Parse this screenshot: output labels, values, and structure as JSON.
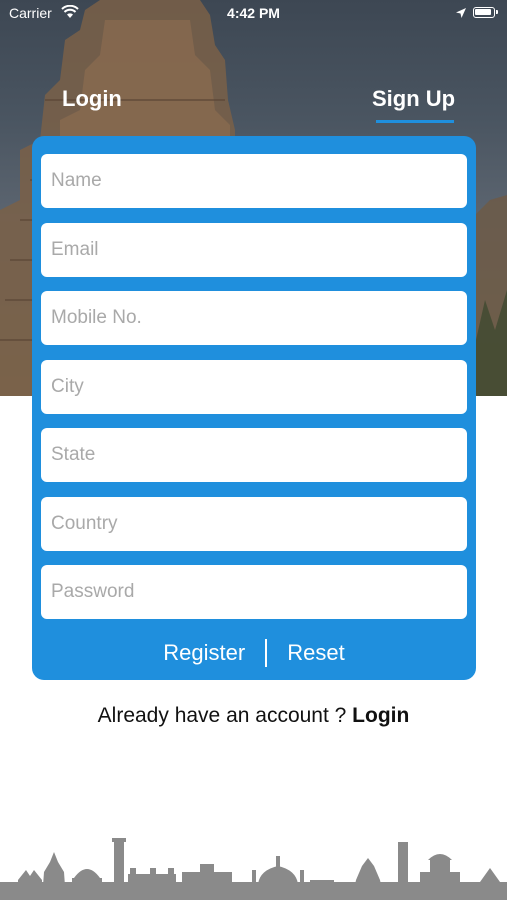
{
  "status_bar": {
    "carrier": "Carrier",
    "time": "4:42 PM",
    "wifi_icon": "wifi-icon",
    "location_icon": "location-arrow-icon",
    "battery_icon": "battery-icon"
  },
  "tabs": {
    "login_label": "Login",
    "signup_label": "Sign Up",
    "active": "signup"
  },
  "form": {
    "fields": [
      {
        "key": "name",
        "placeholder": "Name",
        "value": ""
      },
      {
        "key": "email",
        "placeholder": "Email",
        "value": ""
      },
      {
        "key": "mobile",
        "placeholder": "Mobile No.",
        "value": ""
      },
      {
        "key": "city",
        "placeholder": "City",
        "value": ""
      },
      {
        "key": "state",
        "placeholder": "State",
        "value": ""
      },
      {
        "key": "country",
        "placeholder": "Country",
        "value": ""
      },
      {
        "key": "password",
        "placeholder": "Password",
        "value": ""
      }
    ],
    "register_label": "Register",
    "reset_label": "Reset"
  },
  "footer": {
    "prompt": "Already have an account ? ",
    "login_link": "Login"
  },
  "colors": {
    "accent": "#1f8fdd",
    "skyline": "#8a8a8a"
  }
}
